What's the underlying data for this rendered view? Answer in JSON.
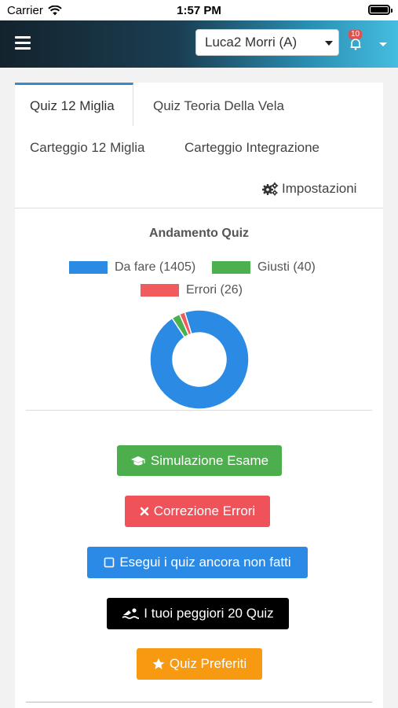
{
  "status_bar": {
    "carrier": "Carrier",
    "time": "1:57 PM"
  },
  "navbar": {
    "user_selected": "Luca2 Morri (A)",
    "notification_count": "10",
    "colors": {
      "gradient_start": "#13232d",
      "gradient_end": "#45bde0"
    }
  },
  "tabs": [
    {
      "label": "Quiz 12 Miglia",
      "active": true
    },
    {
      "label": "Quiz Teoria Della Vela",
      "active": false
    },
    {
      "label": "Carteggio 12 Miglia",
      "active": false
    },
    {
      "label": "Carteggio Integrazione",
      "active": false
    },
    {
      "label": "Impostazioni",
      "icon": "gears-icon",
      "active": false
    }
  ],
  "chart_data": {
    "type": "pie",
    "title": "Andamento Quiz",
    "series": [
      {
        "name": "Da fare (1405)",
        "value": 1405,
        "color": "#2a8ae4"
      },
      {
        "name": "Giusti (40)",
        "value": 40,
        "color": "#4caf50"
      },
      {
        "name": "Errori (26)",
        "value": 26,
        "color": "#f15b5b"
      }
    ],
    "legend_position": "top"
  },
  "actions": [
    {
      "label": "Simulazione Esame",
      "icon": "graduation-cap-icon",
      "color": "#4cae4c"
    },
    {
      "label": "Correzione Errori",
      "icon": "times-icon",
      "color": "#f0525a"
    },
    {
      "label": "Esegui i quiz ancora non fatti",
      "icon": "square-outline-icon",
      "color": "#2b8ae6"
    },
    {
      "label": "I tuoi peggiori 20 Quiz",
      "icon": "swimmer-icon",
      "color": "#000000"
    },
    {
      "label": "Quiz Preferiti",
      "icon": "star-icon",
      "color": "#f79a12"
    }
  ]
}
